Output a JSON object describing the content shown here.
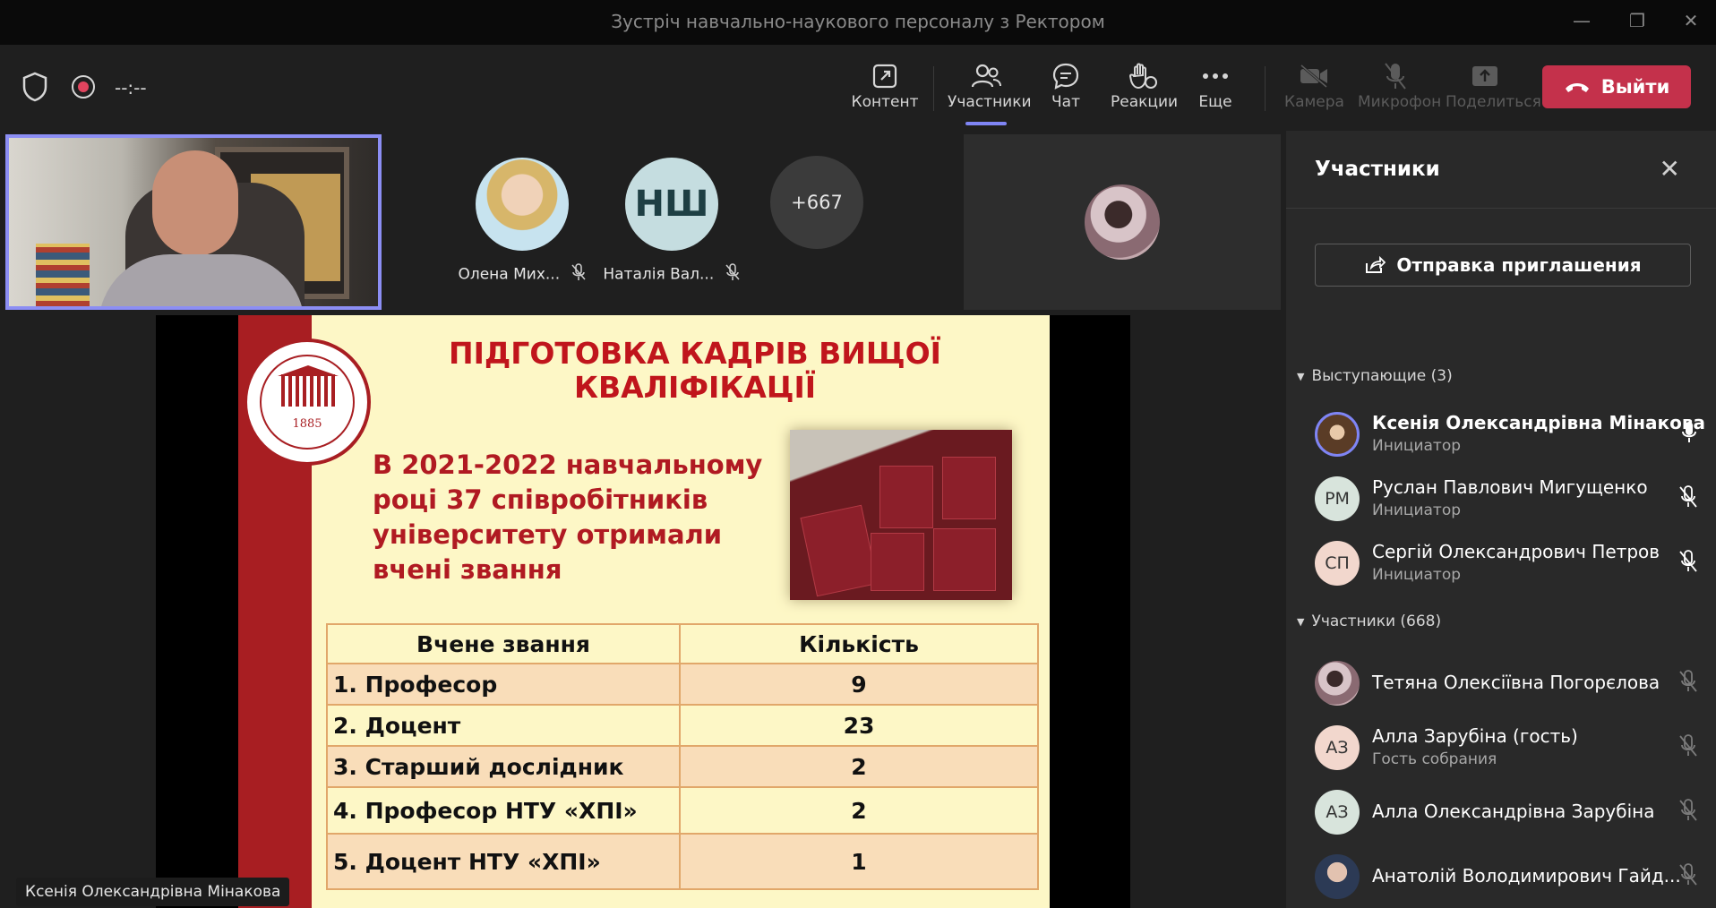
{
  "window": {
    "title": "Зустріч навчально-наукового персоналу з Ректором"
  },
  "toolbar": {
    "timer": "--:--",
    "items": [
      {
        "label": "Контент"
      },
      {
        "label": "Участники"
      },
      {
        "label": "Чат"
      },
      {
        "label": "Реакции"
      },
      {
        "label": "Еще"
      },
      {
        "label": "Камера"
      },
      {
        "label": "Микрофон"
      },
      {
        "label": "Поделиться"
      }
    ],
    "leave_label": "Выйти"
  },
  "stage": {
    "tiles": [
      {
        "name": "Олена Мих..."
      },
      {
        "name": "Наталія Вал...",
        "initials": "НШ"
      },
      {
        "overflow": "+667"
      }
    ],
    "speaker_name": "Ксенія Олександрівна Мінакова"
  },
  "slide": {
    "title": "ПІДГОТОВКА КАДРІВ ВИЩОЇ КВАЛІФІКАЦІЇ",
    "text": "В 2021-2022 навчальному році 37 співробітників університету отримали вчені звання",
    "seal_year": "1885",
    "table": {
      "headers": [
        "Вчене звання",
        "Кількість"
      ],
      "rows": [
        {
          "title": "1. Професор",
          "count": "9"
        },
        {
          "title": "2. Доцент",
          "count": "23"
        },
        {
          "title": "3. Старший дослідник",
          "count": "2"
        },
        {
          "title": "4. Професор НТУ «ХПІ»",
          "count": "2"
        },
        {
          "title": "5. Доцент НТУ «ХПІ»",
          "count": "1"
        }
      ]
    }
  },
  "panel": {
    "title": "Участники",
    "invite_label": "Отправка приглашения",
    "presenters_header": "Выступающие (3)",
    "attendees_header": "Участники (668)",
    "presenters": [
      {
        "name": "Ксенія Олександрівна Мінакова",
        "role": "Инициатор"
      },
      {
        "name": "Руслан Павлович Мигущенко",
        "role": "Инициатор",
        "initials": "РМ"
      },
      {
        "name": "Сергій Олександрович Петров",
        "role": "Инициатор",
        "initials": "СП"
      }
    ],
    "attendees": [
      {
        "name": "Тетяна Олексіївна Погорєлова",
        "role": ""
      },
      {
        "name": "Алла Зарубіна (гость)",
        "role": "Гость собрания",
        "initials": "АЗ"
      },
      {
        "name": "Алла Олександрівна Зарубіна",
        "role": "",
        "initials": "АЗ"
      },
      {
        "name": "Анатолій Володимирович Гайд...",
        "role": ""
      }
    ]
  },
  "colors": {
    "accent": "#7f85f5",
    "leave": "#c4314b",
    "slide_red": "#c0151c"
  }
}
